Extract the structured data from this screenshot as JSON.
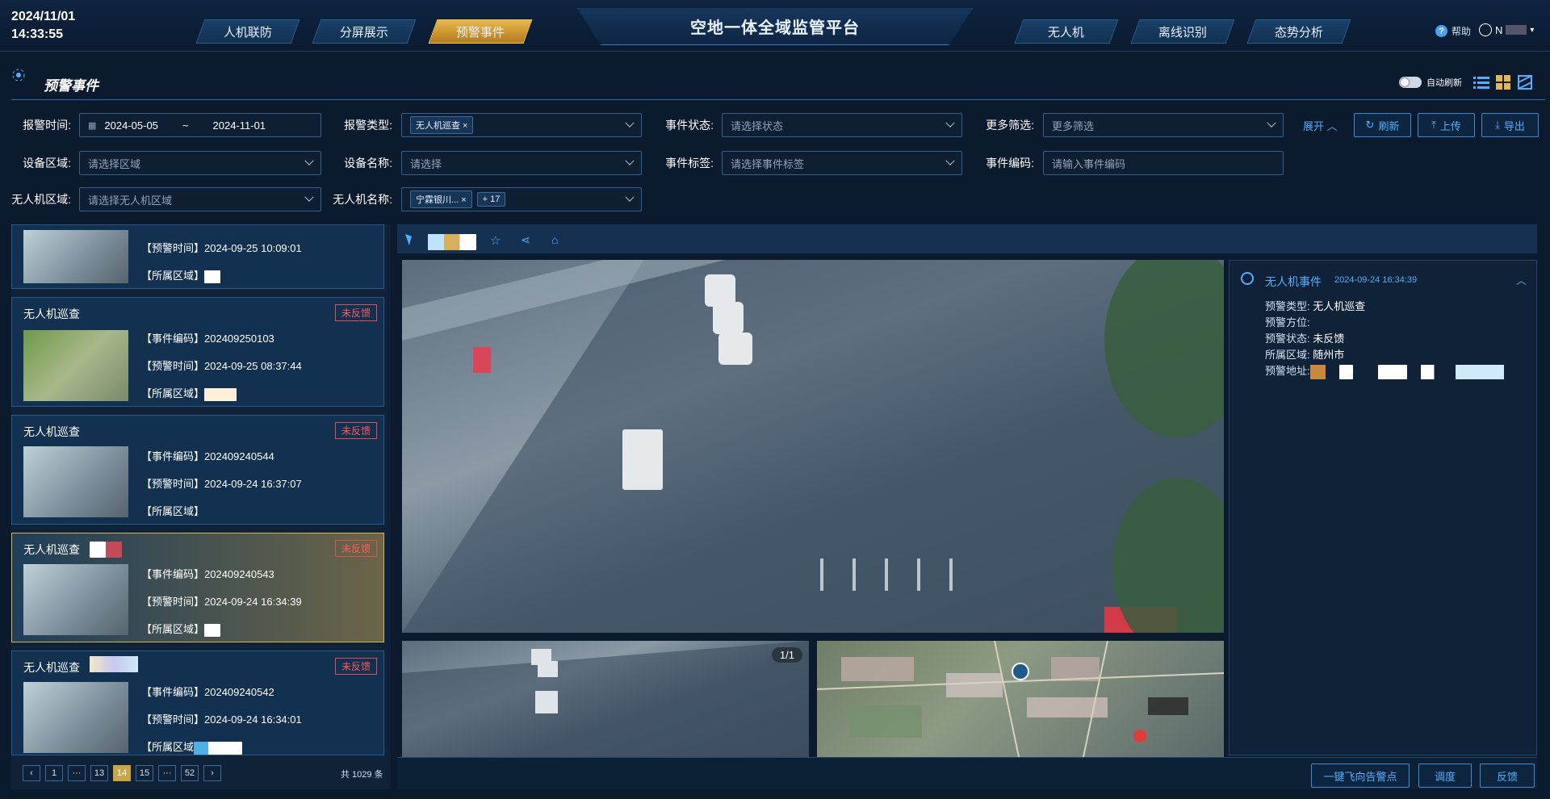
{
  "header": {
    "date": "2024/11/01",
    "time": "14:33:55",
    "title": "空地一体全域监管平台",
    "help": "帮助",
    "user": "N",
    "tabs_left": [
      "人机联防",
      "分屏展示",
      "预警事件"
    ],
    "tabs_right": [
      "无人机",
      "离线识别",
      "态势分析"
    ]
  },
  "page": {
    "title": "预警事件",
    "auto_refresh": "自动刷新"
  },
  "filters": {
    "alarm_time": "报警时间:",
    "date_start": "2024-05-05",
    "date_sep": "~",
    "date_end": "2024-11-01",
    "alarm_type": "报警类型:",
    "alarm_type_tag": "无人机巡查",
    "event_status": "事件状态:",
    "event_status_ph": "请选择状态",
    "more": "更多筛选:",
    "more_ph": "更多筛选",
    "expand": "展开",
    "refresh": "刷新",
    "upload": "上传",
    "export": "导出",
    "device_area": "设备区域:",
    "device_area_ph": "请选择区域",
    "device_name": "设备名称:",
    "device_name_ph": "请选择",
    "event_tag": "事件标签:",
    "event_tag_ph": "请选择事件标签",
    "event_code": "事件编码:",
    "event_code_ph": "请输入事件编码",
    "uav_area": "无人机区域:",
    "uav_area_ph": "请选择无人机区域",
    "uav_name": "无人机名称:",
    "uav_name_tag": "宁霖银川...",
    "uav_name_more": "+ 17"
  },
  "list": {
    "partial": {
      "time_label": "【预警时间】",
      "time": "2024-09-25 10:09:01",
      "area_label": "【所属区域】"
    },
    "items": [
      {
        "title": "无人机巡查",
        "badge": "未反馈",
        "code_label": "【事件编码】",
        "code": "202409250103",
        "time_label": "【预警时间】",
        "time": "2024-09-25 08:37:44",
        "area_label": "【所属区域】"
      },
      {
        "title": "无人机巡查",
        "badge": "未反馈",
        "code_label": "【事件编码】",
        "code": "202409240544",
        "time_label": "【预警时间】",
        "time": "2024-09-24 16:37:07",
        "area_label": "【所属区域】"
      },
      {
        "title": "无人机巡查",
        "badge": "未反馈",
        "code_label": "【事件编码】",
        "code": "202409240543",
        "time_label": "【预警时间】",
        "time": "2024-09-24 16:34:39",
        "area_label": "【所属区域】"
      },
      {
        "title": "无人机巡查",
        "badge": "未反馈",
        "code_label": "【事件编码】",
        "code": "202409240542",
        "time_label": "【预警时间】",
        "time": "2024-09-24 16:34:01",
        "area_label": "【所属区域"
      }
    ],
    "pager": {
      "p1": "1",
      "e1": "···",
      "p13": "13",
      "p14": "14",
      "p15": "15",
      "e2": "···",
      "p52": "52",
      "total": "共 1029 条"
    }
  },
  "detail": {
    "title": "无人机事件",
    "time": "2024-09-24 16:34:39",
    "type_label": "预警类型:",
    "type": "无人机巡查",
    "dir_label": "预警方位:",
    "status_label": "预警状态:",
    "status": "未反馈",
    "area_label": "所属区域:",
    "area": "随州市",
    "addr_label": "预警地址:"
  },
  "media": {
    "counter": "1/1"
  },
  "actions": {
    "fly": "一键飞向告警点",
    "dispatch": "调度",
    "feedback": "反馈"
  }
}
